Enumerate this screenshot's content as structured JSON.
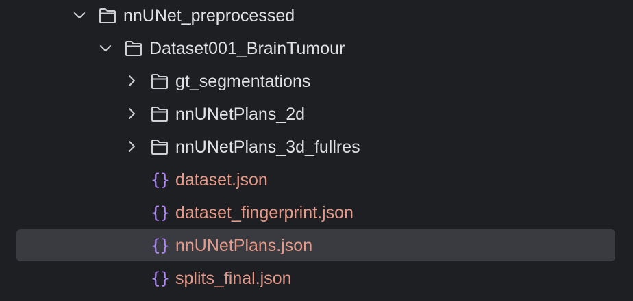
{
  "tree": {
    "items": [
      {
        "label": "nnUNet_preprocessed",
        "type": "folder",
        "expanded": true,
        "icon": "folder-icon"
      },
      {
        "label": "Dataset001_BrainTumour",
        "type": "folder",
        "expanded": true,
        "icon": "folder-icon"
      },
      {
        "label": "gt_segmentations",
        "type": "folder",
        "expanded": false,
        "icon": "folder-icon"
      },
      {
        "label": "nnUNetPlans_2d",
        "type": "folder",
        "expanded": false,
        "icon": "folder-icon"
      },
      {
        "label": "nnUNetPlans_3d_fullres",
        "type": "folder",
        "expanded": false,
        "icon": "folder-icon"
      },
      {
        "label": "dataset.json",
        "type": "file",
        "icon": "json-file-icon",
        "icon_glyph": "{}"
      },
      {
        "label": "dataset_fingerprint.json",
        "type": "file",
        "icon": "json-file-icon",
        "icon_glyph": "{}"
      },
      {
        "label": "nnUNetPlans.json",
        "type": "file",
        "selected": true,
        "icon": "json-file-icon",
        "icon_glyph": "{}"
      },
      {
        "label": "splits_final.json",
        "type": "file",
        "icon": "json-file-icon",
        "icon_glyph": "{}"
      }
    ]
  },
  "colors": {
    "background": "#1e1f22",
    "selection": "#393b40",
    "folder_text": "#dfe1e5",
    "json_text": "#e49a8a",
    "json_icon": "#b189f5",
    "chevron": "#ced0d6"
  }
}
